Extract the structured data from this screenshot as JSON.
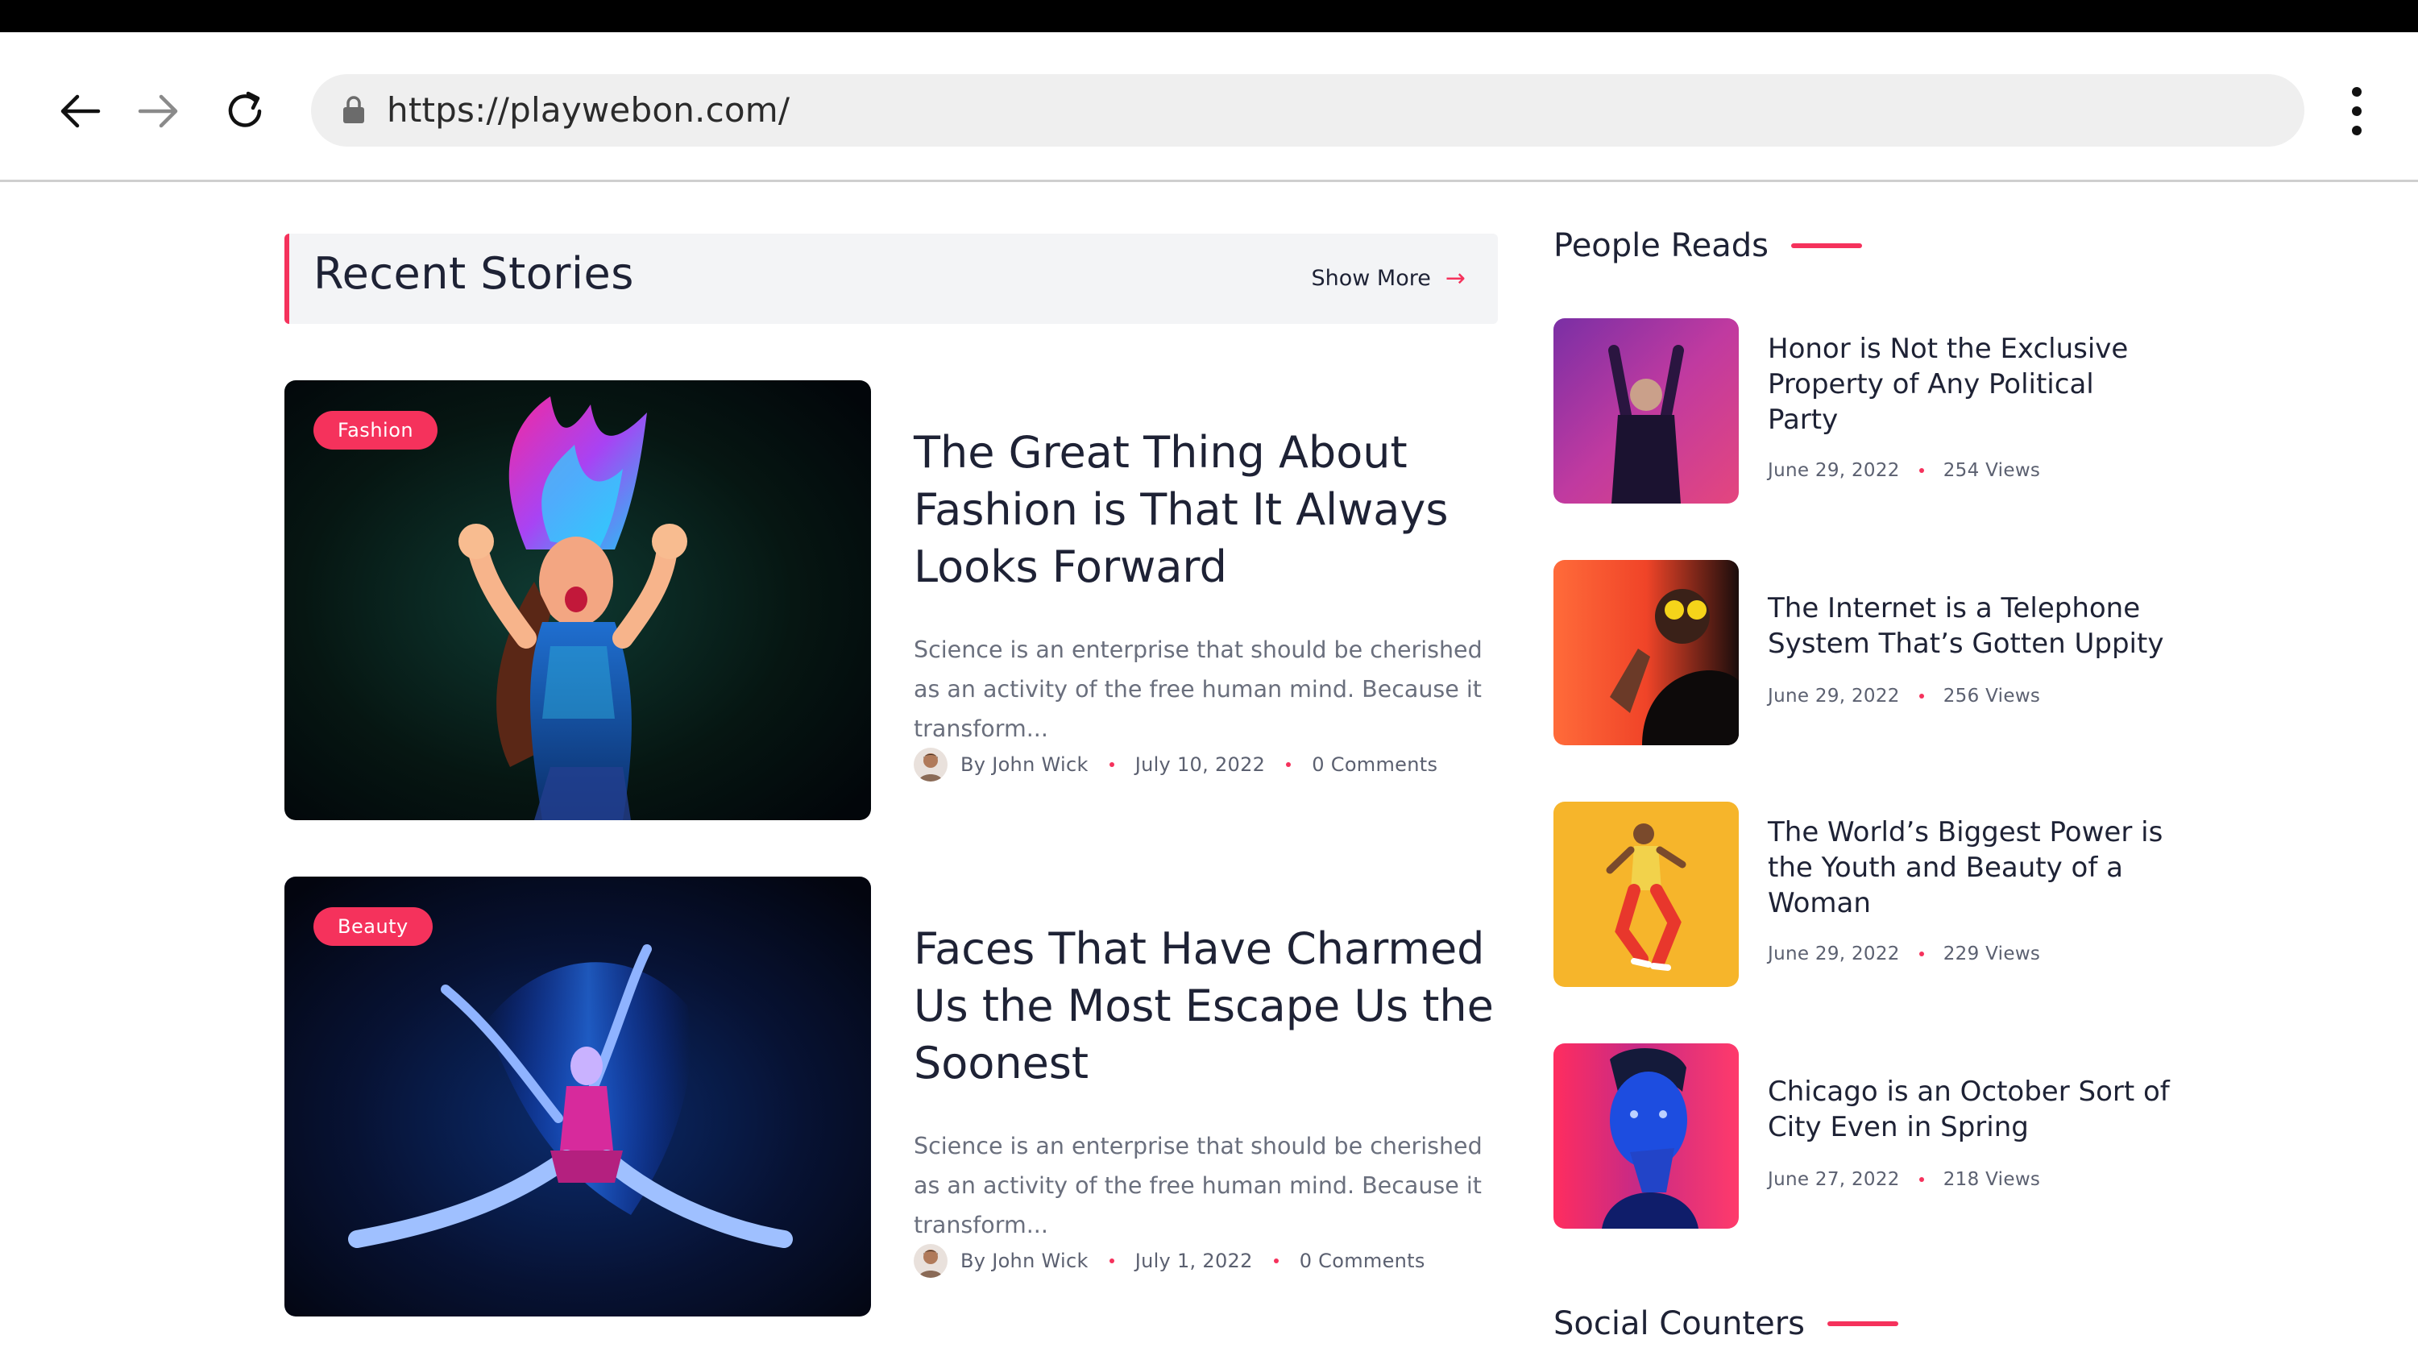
{
  "browser": {
    "url": "https://playwebon.com/",
    "icons": {
      "back": "arrow-left-icon",
      "forward": "arrow-right-icon",
      "reload": "reload-icon",
      "lock": "lock-icon",
      "menu": "kebab-menu-icon"
    }
  },
  "recent": {
    "title": "Recent Stories",
    "show_more": "Show More",
    "stories": [
      {
        "category": "Fashion",
        "title": "The Great Thing About Fashion is That It Always Looks Forward",
        "excerpt": "Science is an enterprise that should be cherished as an activity of the free human mind. Because it transform...",
        "author": "By John Wick",
        "date": "July 10, 2022",
        "comments": "0 Comments"
      },
      {
        "category": "Beauty",
        "title": "Faces That Have Charmed Us the Most Escape Us the Soonest",
        "excerpt": "Science is an enterprise that should be cherished as an activity of the free human mind. Because it transform...",
        "author": "By John Wick",
        "date": "July 1, 2022",
        "comments": "0 Comments"
      }
    ]
  },
  "people_reads": {
    "title": "People Reads",
    "items": [
      {
        "title": "Honor is Not the Exclusive Property of Any Political Party",
        "date": "June 29, 2022",
        "views": "254 Views"
      },
      {
        "title": "The Internet is a Telephone System That’s Gotten Uppity",
        "date": "June 29, 2022",
        "views": "256 Views"
      },
      {
        "title": "The World’s Biggest Power is the Youth and Beauty of a Woman",
        "date": "June 29, 2022",
        "views": "229 Views"
      },
      {
        "title": "Chicago is an October Sort of City Even in Spring",
        "date": "June 27, 2022",
        "views": "218 Views"
      }
    ]
  },
  "social": {
    "title": "Social Counters"
  },
  "colors": {
    "accent": "#f5325c",
    "heading": "#1e2235",
    "muted": "#6a6f7d",
    "panel": "#f3f4f6"
  }
}
